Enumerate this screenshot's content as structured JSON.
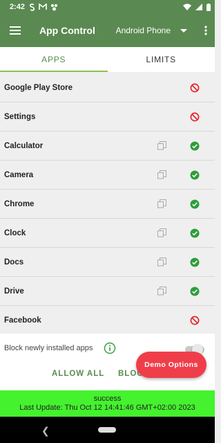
{
  "status_bar": {
    "time": "2:42",
    "icons": [
      "s-icon",
      "gmail-icon",
      "bug-icon"
    ]
  },
  "app_bar": {
    "title": "App Control",
    "device": "Android Phone"
  },
  "tabs": [
    {
      "label": "APPS",
      "active": true
    },
    {
      "label": "LIMITS",
      "active": false
    }
  ],
  "apps": [
    {
      "name": "Google Play Store",
      "copy": false,
      "status": "blocked"
    },
    {
      "name": "Settings",
      "copy": false,
      "status": "blocked"
    },
    {
      "name": "Calculator",
      "copy": true,
      "status": "allowed"
    },
    {
      "name": "Camera",
      "copy": true,
      "status": "allowed"
    },
    {
      "name": "Chrome",
      "copy": true,
      "status": "allowed"
    },
    {
      "name": "Clock",
      "copy": true,
      "status": "allowed"
    },
    {
      "name": "Docs",
      "copy": true,
      "status": "allowed"
    },
    {
      "name": "Drive",
      "copy": true,
      "status": "allowed"
    },
    {
      "name": "Facebook",
      "copy": false,
      "status": "blocked"
    }
  ],
  "block_new": {
    "label": "Block newly installed apps",
    "enabled": false
  },
  "actions": {
    "allow_all": "ALLOW ALL",
    "block_all": "BLOCK ALL"
  },
  "fab": {
    "label": "Demo Options"
  },
  "footer": {
    "status": "success",
    "last_update": "Last Update: Thu Oct 12 14:41:46 GMT+02:00 2023"
  },
  "colors": {
    "primary": "#5a8a51",
    "allowed": "#2e9e3a",
    "blocked": "#e5252a",
    "fab": "#ef3e4a",
    "success": "#44f22e"
  }
}
